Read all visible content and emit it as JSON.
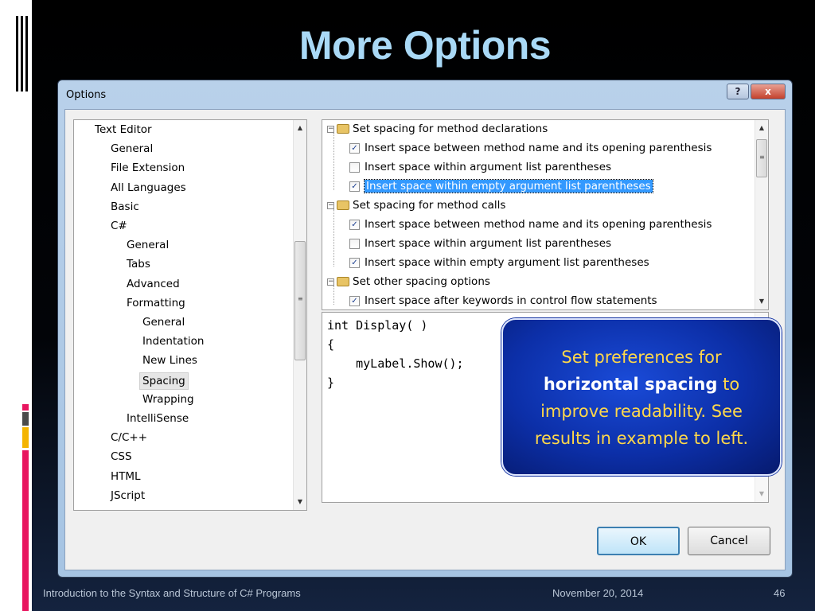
{
  "slide": {
    "title": "More Options",
    "footer_left": "Introduction to the Syntax and Structure of C# Programs",
    "footer_date": "November 20, 2014",
    "page_number": "46"
  },
  "dialog": {
    "title": "Options",
    "help_label": "?",
    "close_label": "x",
    "ok_label": "OK",
    "cancel_label": "Cancel"
  },
  "tree": [
    {
      "label": "Text Editor",
      "level": 0
    },
    {
      "label": "General",
      "level": 1
    },
    {
      "label": "File Extension",
      "level": 1
    },
    {
      "label": "All Languages",
      "level": 1
    },
    {
      "label": "Basic",
      "level": 1
    },
    {
      "label": "C#",
      "level": 1
    },
    {
      "label": "General",
      "level": 2
    },
    {
      "label": "Tabs",
      "level": 2
    },
    {
      "label": "Advanced",
      "level": 2
    },
    {
      "label": "Formatting",
      "level": 2
    },
    {
      "label": "General",
      "level": 3
    },
    {
      "label": "Indentation",
      "level": 3
    },
    {
      "label": "New Lines",
      "level": 3
    },
    {
      "label": "Spacing",
      "level": 3,
      "selected": true
    },
    {
      "label": "Wrapping",
      "level": 3
    },
    {
      "label": "IntelliSense",
      "level": 2
    },
    {
      "label": "C/C++",
      "level": 1
    },
    {
      "label": "CSS",
      "level": 1
    },
    {
      "label": "HTML",
      "level": 1
    },
    {
      "label": "JScript",
      "level": 1
    }
  ],
  "options": {
    "group1": {
      "label": "Set spacing for method declarations",
      "items": [
        {
          "label": "Insert space between method name and its opening parenthesis",
          "checked": true
        },
        {
          "label": "Insert space within argument list parentheses",
          "checked": false
        },
        {
          "label": "Insert space within empty argument list parentheses",
          "checked": true,
          "highlighted": true
        }
      ]
    },
    "group2": {
      "label": "Set spacing for method calls",
      "items": [
        {
          "label": "Insert space between method name and its opening parenthesis",
          "checked": true
        },
        {
          "label": "Insert space within argument list parentheses",
          "checked": false
        },
        {
          "label": "Insert space within empty argument list parentheses",
          "checked": true
        }
      ]
    },
    "group3": {
      "label": "Set other spacing options",
      "items": [
        {
          "label": "Insert space after keywords in control flow statements",
          "checked": true
        }
      ]
    }
  },
  "preview": {
    "lines": [
      "int Display( )",
      "{",
      "    myLabel.Show();",
      "}"
    ]
  },
  "callout": {
    "line1": "Set preferences for",
    "bold": "horizontal spacing",
    "after_bold": " to",
    "line3": "improve readability.  See",
    "line4": "results in example to left."
  },
  "colors": {
    "title": "#a9d9f6",
    "callout_bg": "#0c2fa8",
    "callout_text": "#ffd84a",
    "selection": "#3399ff"
  }
}
